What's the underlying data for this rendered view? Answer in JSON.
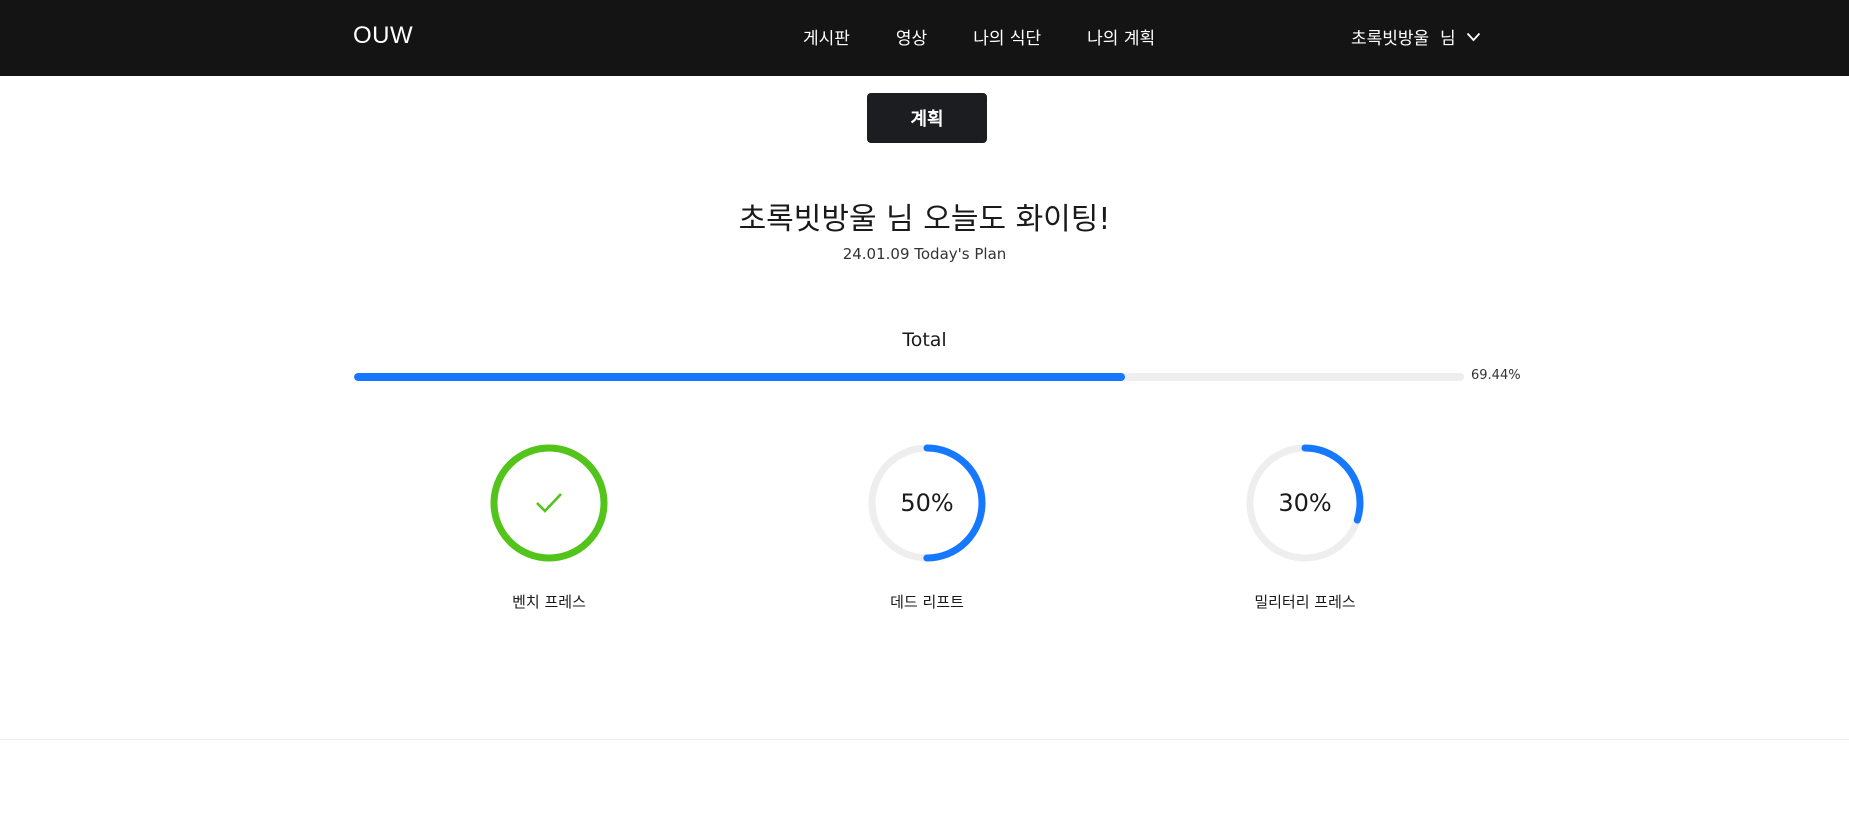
{
  "nav": {
    "brand": "OUW",
    "links": [
      "게시판",
      "영상",
      "나의 식단",
      "나의 계획"
    ],
    "user": "초록빗방울  님"
  },
  "page": {
    "plan_button": "계획",
    "greeting": "초록빗방울 님 오늘도 화이팅!",
    "subtitle": "24.01.09 Today's Plan",
    "total_label": "Total",
    "total_percent": 69.44,
    "total_text": "69.44%"
  },
  "colors": {
    "accent": "#1677ff",
    "success": "#52c41a",
    "track": "#eeeeee",
    "navbar": "#141414"
  },
  "exercises": [
    {
      "name": "벤치 프레스",
      "percent": 100,
      "text": "",
      "status": "success",
      "icon": "check-icon"
    },
    {
      "name": "데드 리프트",
      "percent": 50,
      "text": "50%",
      "status": "normal",
      "icon": ""
    },
    {
      "name": "밀리터리 프레스",
      "percent": 30,
      "text": "30%",
      "status": "normal",
      "icon": ""
    }
  ]
}
